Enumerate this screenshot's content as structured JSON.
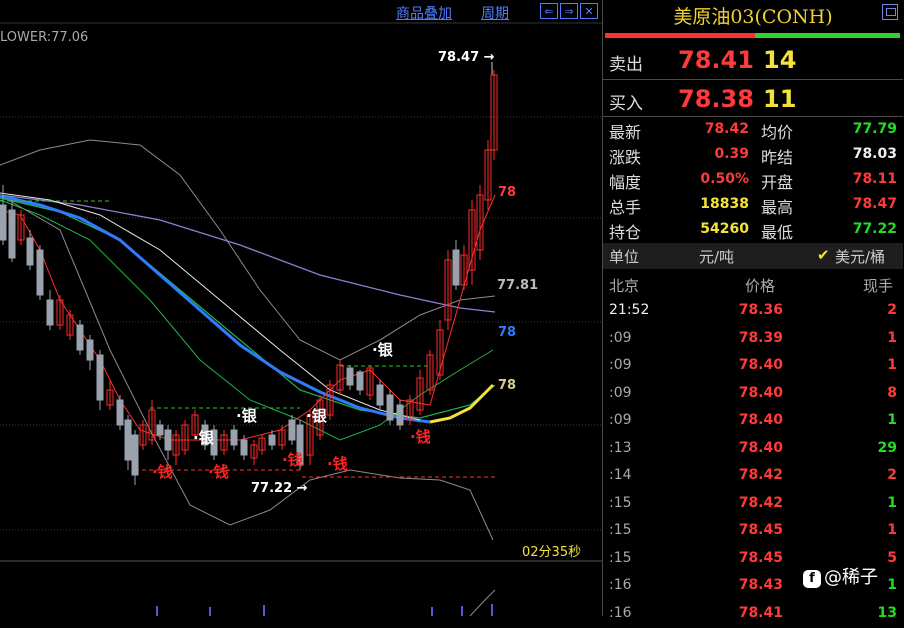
{
  "toolbar": {
    "overlay_label": "商品叠加",
    "period_label": "周期",
    "nav_prev": "⇐",
    "nav_next": "⇒",
    "nav_close": "✕"
  },
  "chart": {
    "lower_label": "LOWER:77.06",
    "timer": "02分35秒",
    "high_marker": "78.47",
    "low_marker": "77.22",
    "level_labels": [
      "78",
      "77.81",
      "78",
      "78"
    ],
    "signal_silver": "银",
    "signal_money": "钱",
    "colors": {
      "up_candle": "#ff2a2a",
      "down_candle": "#9aa3ad",
      "ma_blue": "#2f7bff",
      "ma_yellow": "#f3e23a",
      "ma_green": "#22b04a",
      "ma_purple": "#8f7fd0",
      "bands": "#8c8c8c"
    }
  },
  "panel": {
    "title": "美原油03(CONH)",
    "ask_label": "卖出",
    "ask_price": "78.41",
    "ask_volume": "14",
    "bid_label": "买入",
    "bid_price": "78.38",
    "bid_volume": "11",
    "stats_left": [
      {
        "label": "最新",
        "value": "78.42",
        "color": "#ff3a3a"
      },
      {
        "label": "涨跌",
        "value": "0.39",
        "color": "#ff3a3a"
      },
      {
        "label": "幅度",
        "value": "0.50%",
        "color": "#ff3a3a"
      },
      {
        "label": "总手",
        "value": "18838",
        "color": "#f3e23a"
      },
      {
        "label": "持仓",
        "value": "54260",
        "color": "#f3e23a"
      }
    ],
    "stats_right": [
      {
        "label": "均价",
        "value": "77.79",
        "color": "#22dd22"
      },
      {
        "label": "昨结",
        "value": "78.03",
        "color": "#eeeeee"
      },
      {
        "label": "开盘",
        "value": "78.11",
        "color": "#ff3a3a"
      },
      {
        "label": "最高",
        "value": "78.47",
        "color": "#ff3a3a"
      },
      {
        "label": "最低",
        "value": "77.22",
        "color": "#22dd22"
      }
    ],
    "unit_label": "单位",
    "unit_value": "元/吨",
    "unit_alt": "美元/桶",
    "tick_headers": {
      "time": "北京",
      "price": "价格",
      "volume": "现手"
    },
    "ticks": [
      {
        "time": "21:52",
        "price": "78.36",
        "vol": "2",
        "vol_color": "#ff3a3a"
      },
      {
        "time": ":09",
        "price": "78.39",
        "vol": "1",
        "vol_color": "#ff3a3a"
      },
      {
        "time": ":09",
        "price": "78.40",
        "vol": "1",
        "vol_color": "#ff3a3a"
      },
      {
        "time": ":09",
        "price": "78.40",
        "vol": "8",
        "vol_color": "#ff3a3a"
      },
      {
        "time": ":09",
        "price": "78.40",
        "vol": "1",
        "vol_color": "#22dd22"
      },
      {
        "time": ":13",
        "price": "78.40",
        "vol": "29",
        "vol_color": "#22dd22"
      },
      {
        "time": ":14",
        "price": "78.42",
        "vol": "2",
        "vol_color": "#ff3a3a"
      },
      {
        "time": ":15",
        "price": "78.42",
        "vol": "1",
        "vol_color": "#22dd22"
      },
      {
        "time": ":15",
        "price": "78.45",
        "vol": "1",
        "vol_color": "#ff3a3a"
      },
      {
        "time": ":15",
        "price": "78.45",
        "vol": "5",
        "vol_color": "#ff3a3a"
      },
      {
        "time": ":16",
        "price": "78.43",
        "vol": "1",
        "vol_color": "#22dd22"
      },
      {
        "time": ":16",
        "price": "78.41",
        "vol": "13",
        "vol_color": "#22dd22"
      }
    ]
  },
  "watermark": "@稀子"
}
